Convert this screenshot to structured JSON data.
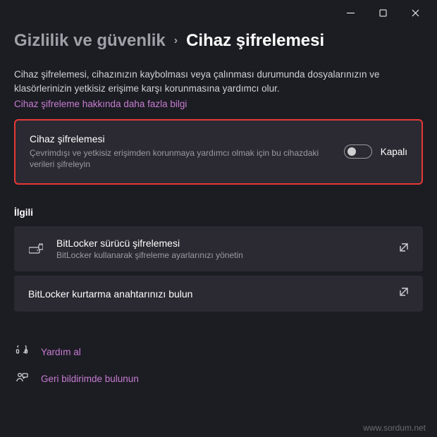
{
  "breadcrumb": {
    "parent": "Gizlilik ve güvenlik",
    "current": "Cihaz şifrelemesi"
  },
  "description": "Cihaz şifrelemesi, cihazınızın kaybolması veya çalınması durumunda dosyalarınızın ve klasörlerinizin yetkisiz erişime karşı korunmasına yardımcı olur.",
  "learn_more": "Cihaz şifreleme hakkında daha fazla bilgi",
  "encryption_card": {
    "title": "Cihaz şifrelemesi",
    "subtitle": "Çevrimdışı ve yetkisiz erişimden korunmaya yardımcı olmak için bu cihazdaki verileri şifreleyin",
    "toggle_state": "Kapalı"
  },
  "related": {
    "label": "İlgili",
    "items": [
      {
        "title": "BitLocker sürücü şifrelemesi",
        "subtitle": "BitLocker kullanarak şifreleme ayarlarınızı yönetin"
      },
      {
        "title": "BitLocker kurtarma anahtarınızı bulun"
      }
    ]
  },
  "footer": {
    "help": "Yardım al",
    "feedback": "Geri bildirimde bulunun"
  },
  "watermark": "www.sordum.net"
}
